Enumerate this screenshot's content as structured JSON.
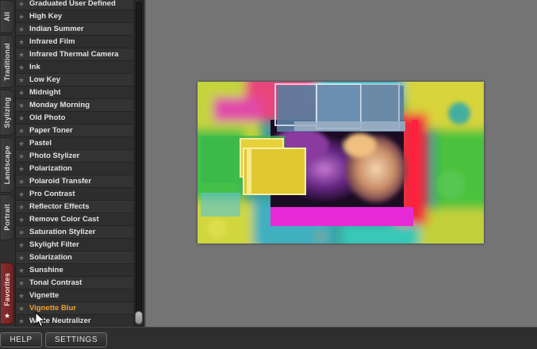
{
  "tabs": {
    "all": "All",
    "traditional": "Traditional",
    "stylizing": "Stylizing",
    "landscape": "Landscape",
    "portrait": "Portrait",
    "favorites": "Favorites"
  },
  "presets": [
    {
      "label": "Graduated User Defined"
    },
    {
      "label": "High Key"
    },
    {
      "label": "Indian Summer"
    },
    {
      "label": "Infrared Film"
    },
    {
      "label": "Infrared Thermal Camera"
    },
    {
      "label": "Ink"
    },
    {
      "label": "Low Key"
    },
    {
      "label": "Midnight"
    },
    {
      "label": "Monday Morning"
    },
    {
      "label": "Old Photo"
    },
    {
      "label": "Paper Toner"
    },
    {
      "label": "Pastel"
    },
    {
      "label": "Photo Stylizer"
    },
    {
      "label": "Polarization"
    },
    {
      "label": "Polaroid Transfer"
    },
    {
      "label": "Pro Contrast"
    },
    {
      "label": "Reflector Effects"
    },
    {
      "label": "Remove Color Cast"
    },
    {
      "label": "Saturation Stylizer"
    },
    {
      "label": "Skylight Filter"
    },
    {
      "label": "Solarization"
    },
    {
      "label": "Sunshine"
    },
    {
      "label": "Tonal Contrast"
    },
    {
      "label": "Vignette"
    },
    {
      "label": "Vignette Blur",
      "active": true
    },
    {
      "label": "White Neutralizer"
    }
  ],
  "bottom_bar": {
    "help_label": "HELP",
    "settings_label": "SETTINGS"
  },
  "colors": {
    "active_item": "#f0a030",
    "favorites_tab": "#8a2e2e",
    "preview_bg": "#747474"
  }
}
